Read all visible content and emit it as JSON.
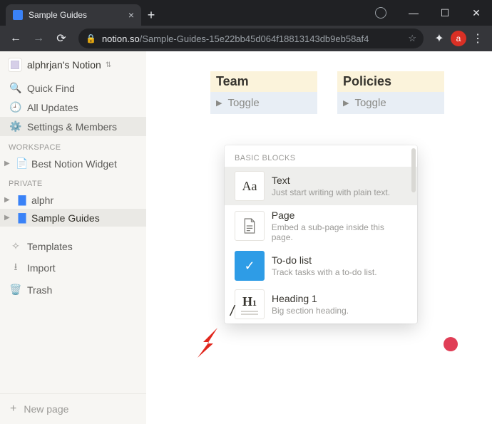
{
  "browser": {
    "tab_title": "Sample Guides",
    "url_host": "notion.so",
    "url_path": "/Sample-Guides-15e22bb45d064f18813143db9eb58af4",
    "avatar_letter": "a"
  },
  "sidebar": {
    "workspace_name": "alphrjan's Notion",
    "quick_find": "Quick Find",
    "all_updates": "All Updates",
    "settings": "Settings & Members",
    "section_workspace": "WORKSPACE",
    "section_private": "PRIVATE",
    "workspace_pages": [
      {
        "icon": "📄",
        "title": "Best Notion Widget"
      }
    ],
    "private_pages": [
      {
        "icon": "🟦",
        "title": "alphr",
        "color": "#3a82f7"
      },
      {
        "icon": "🟦",
        "title": "Sample Guides",
        "color": "#3a82f7",
        "active": true
      }
    ],
    "templates": "Templates",
    "import": "Import",
    "trash": "Trash",
    "new_page": "New page"
  },
  "main": {
    "cards": [
      {
        "title": "Team",
        "toggle": "Toggle"
      },
      {
        "title": "Policies",
        "toggle": "Toggle"
      }
    ],
    "slash_char": "/"
  },
  "slash_menu": {
    "section": "BASIC BLOCKS",
    "items": [
      {
        "icon": "Aa",
        "title": "Text",
        "desc": "Just start writing with plain text."
      },
      {
        "icon": "page",
        "title": "Page",
        "desc": "Embed a sub-page inside this page."
      },
      {
        "icon": "todo",
        "title": "To-do list",
        "desc": "Track tasks with a to-do list."
      },
      {
        "icon": "H1",
        "title": "Heading 1",
        "desc": "Big section heading."
      }
    ]
  }
}
